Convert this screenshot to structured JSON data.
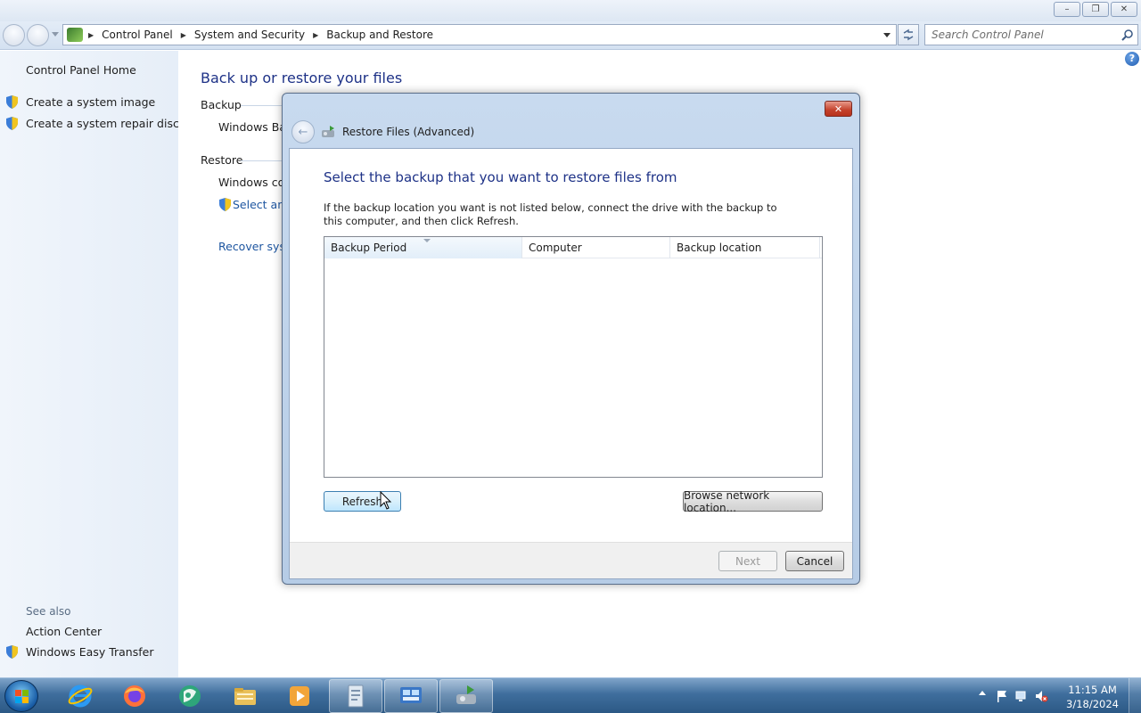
{
  "window": {
    "minimize_glyph": "–",
    "maximize_glyph": "❐",
    "close_glyph": "✕"
  },
  "address_bar": {
    "breadcrumbs": [
      "Control Panel",
      "System and Security",
      "Backup and Restore"
    ],
    "search_placeholder": "Search Control Panel"
  },
  "left_pane": {
    "home_link": "Control Panel Home",
    "links": [
      "Create a system image",
      "Create a system repair disc"
    ],
    "see_also_label": "See also",
    "see_also_links": [
      "Action Center",
      "Windows Easy Transfer"
    ]
  },
  "main": {
    "title": "Back up or restore your files",
    "backup_heading": "Backup",
    "backup_text": "Windows Bac",
    "restore_heading": "Restore",
    "restore_text": "Windows cou",
    "select_link": "Select ano",
    "recover_link": "Recover syste",
    "help_glyph": "?"
  },
  "dialog": {
    "title": "Restore Files (Advanced)",
    "heading": "Select the backup that you want to restore files from",
    "instruction": "If the backup location you want is not listed below, connect the drive with the backup to this computer, and then click Refresh.",
    "columns": [
      "Backup Period",
      "Computer",
      "Backup location"
    ],
    "rows": [],
    "refresh_button": "Refresh",
    "browse_button": "Browse network location...",
    "next_button": "Next",
    "cancel_button": "Cancel",
    "close_glyph": "✕",
    "back_glyph": "←"
  },
  "taskbar": {
    "pinned": [
      "internet-explorer-icon",
      "firefox-icon",
      "media-center-icon",
      "file-explorer-icon",
      "media-player-icon",
      "document-icon",
      "control-panel-icon",
      "backup-restore-icon"
    ],
    "clock_time": "11:15 AM",
    "clock_date": "3/18/2024"
  },
  "colors": {
    "heading_blue": "#1e3287",
    "link_blue": "#1e56a0",
    "taskbar": "#3f6e9d"
  }
}
